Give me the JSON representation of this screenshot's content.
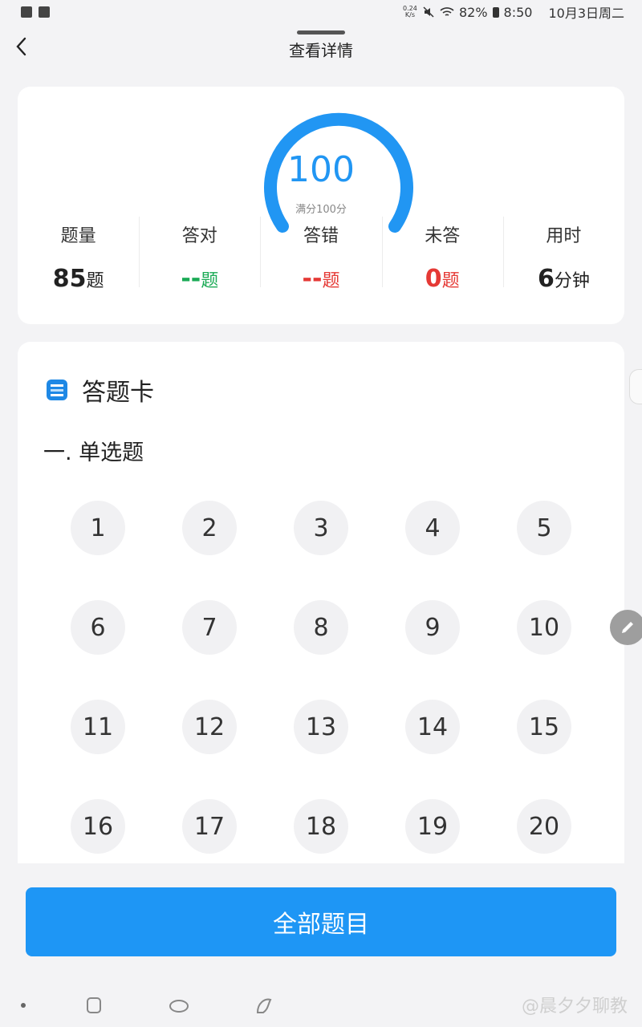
{
  "status_bar": {
    "net_speed": "0.24\nK/s",
    "battery": "82%",
    "time": "8:50",
    "date": "10月3日周二"
  },
  "header": {
    "title": "查看详情"
  },
  "score": {
    "value": "100",
    "subtitle": "满分100分",
    "gauge_color": "#2196f3"
  },
  "stats": [
    {
      "label": "题量",
      "value": "85",
      "unit": "题",
      "color": "dark"
    },
    {
      "label": "答对",
      "value": "--",
      "unit": "题",
      "color": "green"
    },
    {
      "label": "答错",
      "value": "--",
      "unit": "题",
      "color": "red"
    },
    {
      "label": "未答",
      "value": "0",
      "unit": "题",
      "color": "red"
    },
    {
      "label": "用时",
      "value": "6",
      "unit": "分钟",
      "color": "dark"
    }
  ],
  "answer_card": {
    "title": "答题卡",
    "section": "一. 单选题",
    "questions": [
      "1",
      "2",
      "3",
      "4",
      "5",
      "6",
      "7",
      "8",
      "9",
      "10",
      "11",
      "12",
      "13",
      "14",
      "15",
      "16",
      "17",
      "18",
      "19",
      "20"
    ]
  },
  "bottom_button": {
    "label": "全部题目",
    "color": "#1e96f5"
  },
  "watermark": "@晨夕夕聊教"
}
